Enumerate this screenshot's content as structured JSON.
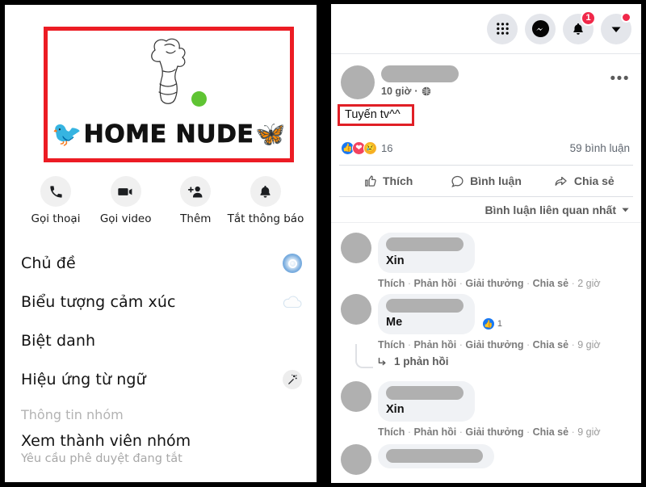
{
  "left_panel": {
    "group_logo": {
      "title": "HOME NUDE",
      "bird_icon": "bluebird-emoji",
      "butterfly_icon": "butterfly-emoji",
      "line_art_icon": "figure-line-art",
      "online_dot": "online-status-dot",
      "highlight_color": "#ec1c24"
    },
    "quick_actions": [
      {
        "label": "Gọi thoại",
        "icon": "phone-icon"
      },
      {
        "label": "Gọi video",
        "icon": "video-camera-icon"
      },
      {
        "label": "Thêm",
        "icon": "add-person-icon"
      },
      {
        "label": "Tắt thông báo",
        "icon": "bell-icon"
      }
    ],
    "menu_items": [
      {
        "label": "Chủ đề",
        "icon": "theme-circle-icon"
      },
      {
        "label": "Biểu tượng cảm xúc",
        "icon": "cloud-icon"
      },
      {
        "label": "Biệt danh",
        "icon": ""
      },
      {
        "label": "Hiệu ứng từ ngữ",
        "icon": "magic-wand-icon"
      }
    ],
    "section_label": "Thông tin nhóm",
    "members": {
      "title": "Xem thành viên nhóm",
      "subtitle": "Yêu cầu phê duyệt đang tắt"
    }
  },
  "right_panel": {
    "header_buttons": [
      {
        "name": "menu-grid-icon",
        "badge": ""
      },
      {
        "name": "messenger-icon",
        "badge": ""
      },
      {
        "name": "notifications-bell-icon",
        "badge": "1"
      },
      {
        "name": "account-chevron-icon",
        "badge": "•"
      }
    ],
    "post": {
      "author_redacted": true,
      "time": "10 giờ",
      "privacy_icon": "globe-icon",
      "more_options": "•••",
      "text": "Tuyến tv^^",
      "text_highlight_color": "#e01f26",
      "reaction_icons": [
        "like-icon",
        "love-icon",
        "sad-icon"
      ],
      "reaction_count": "16",
      "comment_count": "59 bình luận"
    },
    "actions": [
      {
        "label": "Thích",
        "icon": "thumbs-up-icon"
      },
      {
        "label": "Bình luận",
        "icon": "comment-bubble-icon"
      },
      {
        "label": "Chia sẻ",
        "icon": "share-arrow-icon"
      }
    ],
    "sort": {
      "label": "Bình luận liên quan nhất",
      "icon": "chevron-down-icon"
    },
    "comment_meta_actions": [
      "Thích",
      "Phản hồi",
      "Giải thưởng",
      "Chia sẻ"
    ],
    "comments": [
      {
        "text": "Xin",
        "time": "2 giờ",
        "likes": "",
        "has_like_pill": false,
        "reply_link": ""
      },
      {
        "text": "Me",
        "time": "9 giờ",
        "likes": "1",
        "has_like_pill": true,
        "reply_link": "1 phản hồi"
      },
      {
        "text": "Xin",
        "time": "9 giờ",
        "likes": "",
        "has_like_pill": false,
        "reply_link": ""
      }
    ]
  }
}
